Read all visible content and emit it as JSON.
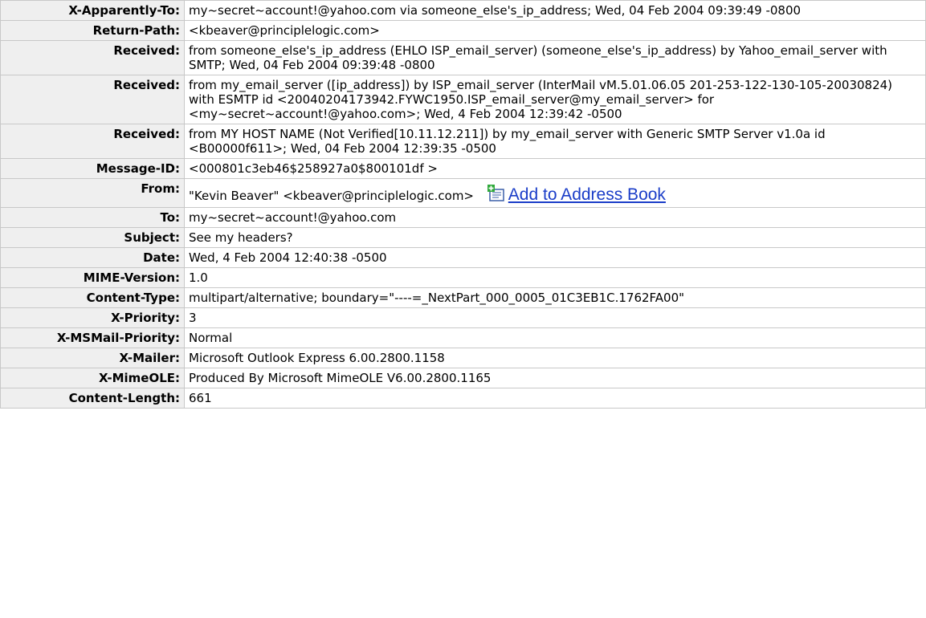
{
  "headers": [
    {
      "name": "X-Apparently-To:",
      "value": "my~secret~account!@yahoo.com via someone_else's_ip_address; Wed, 04 Feb 2004 09:39:49 -0800"
    },
    {
      "name": "Return-Path:",
      "value": "<kbeaver@principlelogic.com>"
    },
    {
      "name": "Received:",
      "value": "from someone_else's_ip_address (EHLO ISP_email_server) (someone_else's_ip_address) by Yahoo_email_server with SMTP; Wed, 04 Feb 2004 09:39:48 -0800"
    },
    {
      "name": "Received:",
      "value": "from my_email_server ([ip_address]) by ISP_email_server (InterMail vM.5.01.06.05 201-253-122-130-105-20030824) with ESMTP id <20040204173942.FYWC1950.ISP_email_server@my_email_server> for <my~secret~account!@yahoo.com>; Wed, 4 Feb 2004 12:39:42 -0500"
    },
    {
      "name": "Received:",
      "value": "from MY HOST NAME (Not Verified[10.11.12.211]) by my_email_server with Generic SMTP Server v1.0a id <B00000f611>; Wed, 04 Feb 2004 12:39:35 -0500"
    },
    {
      "name": "Message-ID:",
      "value": "<000801c3eb46$258927a0$800101df >"
    },
    {
      "name": "From:",
      "value": "\"Kevin Beaver\" <kbeaver@principlelogic.com>",
      "link": "Add to Address Book",
      "icon": "address-book-add-icon"
    },
    {
      "name": "To:",
      "value": "my~secret~account!@yahoo.com"
    },
    {
      "name": "Subject:",
      "value": "See my headers?"
    },
    {
      "name": "Date:",
      "value": "Wed, 4 Feb 2004 12:40:38 -0500"
    },
    {
      "name": "MIME-Version:",
      "value": "1.0"
    },
    {
      "name": "Content-Type:",
      "value": "multipart/alternative; boundary=\"----=_NextPart_000_0005_01C3EB1C.1762FA00\""
    },
    {
      "name": "X-Priority:",
      "value": "3"
    },
    {
      "name": "X-MSMail-Priority:",
      "value": "Normal"
    },
    {
      "name": "X-Mailer:",
      "value": "Microsoft Outlook Express 6.00.2800.1158"
    },
    {
      "name": "X-MimeOLE:",
      "value": "Produced By Microsoft MimeOLE V6.00.2800.1165"
    },
    {
      "name": "Content-Length:",
      "value": "661"
    }
  ],
  "colors": {
    "label_bg": "#efefef",
    "border": "#c8c8c8",
    "link": "#1a3dc8"
  }
}
